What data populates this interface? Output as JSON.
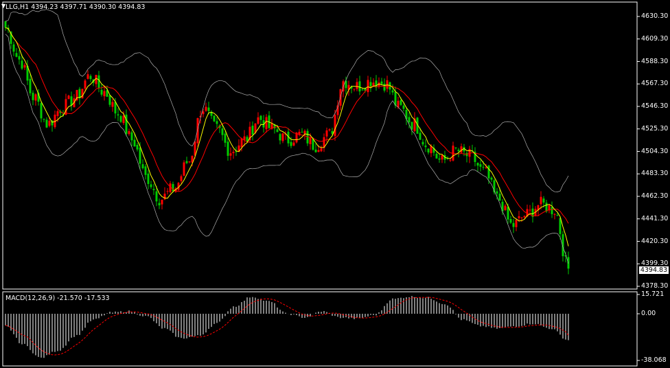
{
  "header": {
    "symbol": "LLG,H1",
    "open": "4394.23",
    "high": "4397.71",
    "low": "4390.30",
    "close": "4394.83",
    "arrow": "▼"
  },
  "price_axis": {
    "ticks": [
      "4630.30",
      "4609.30",
      "4588.30",
      "4567.30",
      "4546.30",
      "4525.30",
      "4504.30",
      "4483.30",
      "4462.30",
      "4441.30",
      "4420.30",
      "4399.30",
      "4378.30"
    ],
    "current": "4394.83"
  },
  "macd": {
    "label": "MACD(12,26,9) -21.570 -17.533",
    "ticks": [
      "15.721",
      "0.00",
      "-38.068"
    ]
  },
  "colors": {
    "background": "#000000",
    "bull_candle": "#ff0000",
    "bear_candle": "#00cc00",
    "fast_ma": "#ffff00",
    "slow_ma": "#ff0000",
    "bollinger": "#b0b0b0",
    "macd_hist": "#ffffff",
    "macd_signal": "#ff0000",
    "border": "#ffffff"
  },
  "chart_data": [
    {
      "type": "candlestick",
      "symbol": "LLG",
      "timeframe": "H1",
      "ylim": [
        4378.3,
        4635.0
      ],
      "overlays": [
        "moving-average-fast (yellow)",
        "moving-average-slow (red)",
        "bollinger-bands (grey)"
      ],
      "key_closes": [
        4620,
        4590,
        4555,
        4530,
        4545,
        4555,
        4575,
        4560,
        4540,
        4515,
        4480,
        4460,
        4470,
        4495,
        4545,
        4525,
        4505,
        4515,
        4535,
        4525,
        4515,
        4520,
        4510,
        4520,
        4570,
        4565,
        4570,
        4568,
        4545,
        4530,
        4510,
        4495,
        4505,
        4500,
        4485,
        4460,
        4435,
        4445,
        4455,
        4450,
        4394.83
      ]
    },
    {
      "type": "bar",
      "name": "MACD(12,26,9)",
      "ylim": [
        -38.068,
        15.721
      ],
      "macd": -21.57,
      "signal": -17.533,
      "key_values": [
        -10,
        -25,
        -36,
        -30,
        -18,
        -5,
        1,
        2,
        -2,
        -12,
        -20,
        -18,
        -8,
        6,
        14,
        10,
        0,
        -3,
        2,
        -3,
        -4,
        -1,
        12,
        14,
        13,
        8,
        -5,
        -10,
        -12,
        -10,
        -8,
        -12,
        -21.57
      ]
    }
  ]
}
